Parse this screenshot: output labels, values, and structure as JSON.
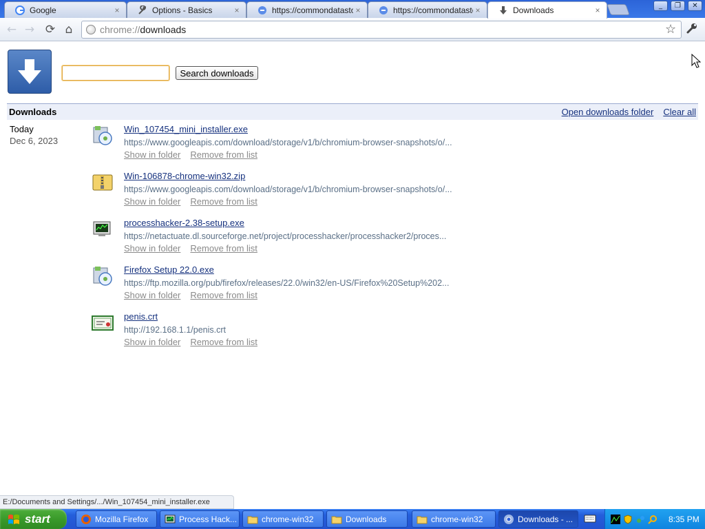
{
  "tabs": [
    {
      "label": "Google",
      "icon": "google-icon",
      "active": false
    },
    {
      "label": "Options - Basics",
      "icon": "wrench-icon",
      "active": false
    },
    {
      "label": "https://commondatastorage",
      "icon": "globe-icon",
      "active": false
    },
    {
      "label": "https://commondatastorage",
      "icon": "globe-icon",
      "active": false
    },
    {
      "label": "Downloads",
      "icon": "download-icon",
      "active": true
    }
  ],
  "tab_close": "×",
  "window_buttons": {
    "minimize": "_",
    "maximize": "❐",
    "close": "✕"
  },
  "toolbar": {
    "back": "←",
    "forward": "→",
    "reload": "⟳",
    "home": "⌂",
    "url_scheme": "chrome://",
    "url_host": "downloads",
    "star": "☆",
    "wrench": "🔧"
  },
  "search": {
    "value": "",
    "button_label": "Search downloads"
  },
  "section": {
    "title": "Downloads",
    "open_folder_link": "Open downloads folder",
    "clear_all_link": "Clear all"
  },
  "date_group": {
    "label": "Today",
    "date": "Dec 6, 2023"
  },
  "downloads": [
    {
      "name": "Win_107454_mini_installer.exe",
      "url": "https://www.googleapis.com/download/storage/v1/b/chromium-browser-snapshots/o/...",
      "icon": "installer-icon",
      "show_in_folder": "Show in folder",
      "remove": "Remove from list"
    },
    {
      "name": "Win-106878-chrome-win32.zip",
      "url": "https://www.googleapis.com/download/storage/v1/b/chromium-browser-snapshots/o/...",
      "icon": "zip-archive-icon",
      "show_in_folder": "Show in folder",
      "remove": "Remove from list"
    },
    {
      "name": "processhacker-2.38-setup.exe",
      "url": "https://netactuate.dl.sourceforge.net/project/processhacker/processhacker2/proces...",
      "icon": "monitor-app-icon",
      "show_in_folder": "Show in folder",
      "remove": "Remove from list"
    },
    {
      "name": "Firefox Setup 22.0.exe",
      "url": "https://ftp.mozilla.org/pub/firefox/releases/22.0/win32/en-US/Firefox%20Setup%202...",
      "icon": "installer-icon",
      "show_in_folder": "Show in folder",
      "remove": "Remove from list"
    },
    {
      "name": "penis.crt",
      "url": "http://192.168.1.1/penis.crt",
      "icon": "certificate-icon",
      "show_in_folder": "Show in folder",
      "remove": "Remove from list"
    }
  ],
  "status_text": "E:/Documents and Settings/.../Win_107454_mini_installer.exe",
  "taskbar": {
    "start_label": "start",
    "tasks": [
      {
        "label": "Mozilla Firefox",
        "icon": "firefox-icon",
        "active": false
      },
      {
        "label": "Process Hack...",
        "icon": "process-hacker-icon",
        "active": false
      },
      {
        "label": "chrome-win32",
        "icon": "folder-icon",
        "active": false
      },
      {
        "label": "Downloads",
        "icon": "folder-icon",
        "active": false
      },
      {
        "label": "chrome-win32",
        "icon": "folder-icon",
        "active": false
      },
      {
        "label": "Downloads - ...",
        "icon": "chromium-icon",
        "active": true
      }
    ],
    "clock": "8:35 PM"
  },
  "colors": {
    "link": "#15317e",
    "url_gray": "#5a6f86",
    "section_bg": "#ebeff9",
    "taskbar_blue": "#245edb",
    "start_green": "#3a9a2a"
  }
}
